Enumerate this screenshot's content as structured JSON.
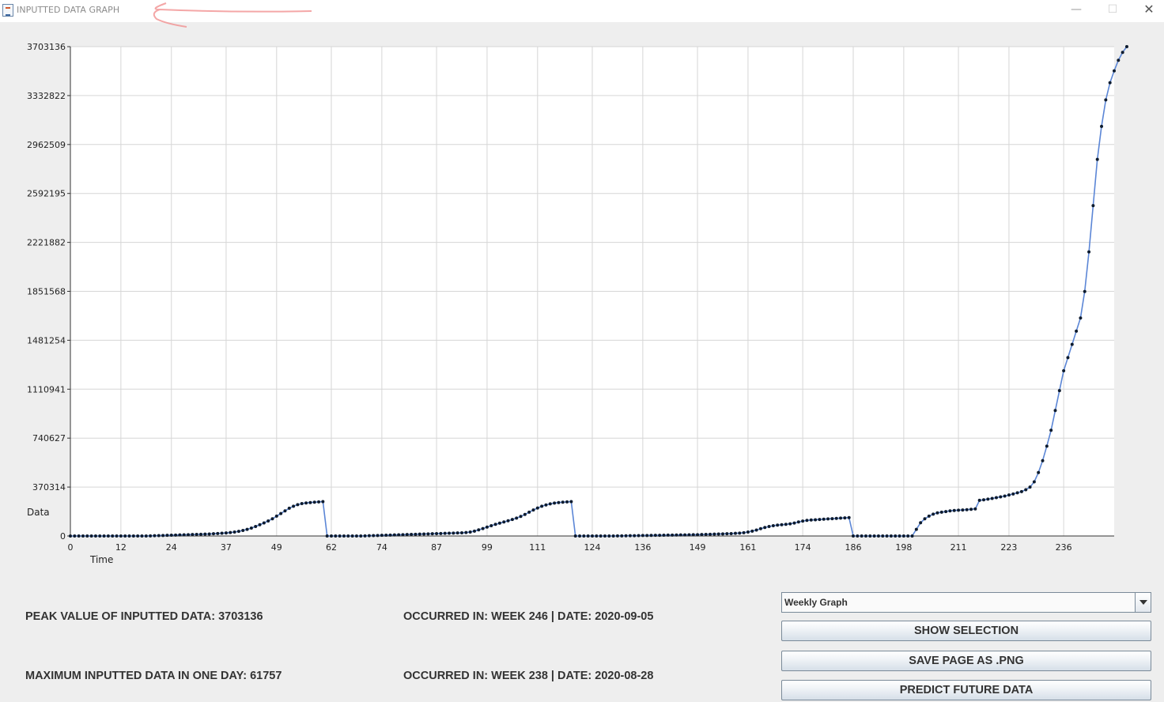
{
  "window": {
    "title": "INPUTTED DATA GRAPH",
    "controls": {
      "minimize": "—",
      "maximize": "☐",
      "close": "✕"
    }
  },
  "chart_data": {
    "type": "line",
    "title": "",
    "xlabel": "Time",
    "ylabel": "Data",
    "x_ticks": [
      "0",
      "12",
      "24",
      "37",
      "49",
      "62",
      "74",
      "87",
      "99",
      "111",
      "124",
      "136",
      "149",
      "161",
      "174",
      "186",
      "198",
      "211",
      "223",
      "236"
    ],
    "y_ticks": [
      "0",
      "370314",
      "740627",
      "1110941",
      "1481254",
      "1851568",
      "2221882",
      "2592195",
      "2962509",
      "3332822",
      "3703136"
    ],
    "xlim": [
      0,
      248
    ],
    "ylim": [
      0,
      3703136
    ],
    "grid": true,
    "line_color": "#5b86d6",
    "marker_color": "#0d1b2e",
    "series": [
      {
        "values": [
          0,
          0,
          0,
          0,
          0,
          0,
          0,
          0,
          0,
          0,
          0,
          0,
          0,
          0,
          0,
          0,
          0,
          0,
          0,
          1000,
          2000,
          3000,
          4000,
          5000,
          6000,
          7000,
          8000,
          9000,
          10000,
          11000,
          12000,
          13000,
          14000,
          15000,
          17000,
          19000,
          21000,
          23000,
          26000,
          30000,
          35000,
          42000,
          50000,
          60000,
          72000,
          85000,
          99000,
          114000,
          130000,
          150000,
          170000,
          190000,
          210000,
          225000,
          237000,
          245000,
          250000,
          253000,
          256000,
          258000,
          260000,
          0,
          0,
          0,
          0,
          0,
          0,
          0,
          0,
          0,
          1000,
          2000,
          3000,
          4000,
          5000,
          6000,
          7000,
          8000,
          9000,
          10000,
          11000,
          12000,
          13000,
          14000,
          15000,
          16000,
          17000,
          18000,
          19000,
          20000,
          21000,
          22000,
          23000,
          24000,
          26000,
          30000,
          37000,
          46000,
          56000,
          67000,
          78000,
          88000,
          97000,
          106000,
          115000,
          125000,
          135000,
          148000,
          163000,
          180000,
          197000,
          212000,
          225000,
          235000,
          243000,
          249000,
          253000,
          256000,
          258000,
          260000,
          0,
          0,
          0,
          0,
          0,
          0,
          0,
          0,
          0,
          0,
          500,
          1000,
          1500,
          2000,
          2500,
          3000,
          3500,
          4000,
          4500,
          5000,
          5500,
          6000,
          6500,
          7000,
          7500,
          8000,
          8500,
          9000,
          9500,
          10000,
          11000,
          12000,
          13000,
          14000,
          15000,
          16000,
          17000,
          18000,
          20000,
          22000,
          25000,
          30000,
          37000,
          45000,
          55000,
          64000,
          72000,
          78000,
          82000,
          85000,
          88000,
          92000,
          98000,
          106000,
          113000,
          118000,
          121000,
          123000,
          125000,
          127000,
          129000,
          131000,
          133000,
          135000,
          137000,
          139000,
          0,
          0,
          0,
          0,
          0,
          0,
          0,
          0,
          0,
          0,
          0,
          0,
          0,
          0,
          0,
          50000,
          100000,
          130000,
          150000,
          165000,
          175000,
          180000,
          185000,
          190000,
          193000,
          195000,
          197000,
          199000,
          202000,
          205000,
          270000,
          274000,
          279000,
          284000,
          290000,
          296000,
          302000,
          310000,
          318000,
          327000,
          336000,
          350000,
          370000,
          410000,
          480000,
          570000,
          680000,
          800000,
          950000,
          1100000,
          1250000,
          1350000,
          1450000,
          1550000,
          1650000,
          1850000,
          2150000,
          2500000,
          2850000,
          3100000,
          3300000,
          3430000,
          3520000,
          3600000,
          3660000,
          3703136
        ]
      }
    ]
  },
  "stats": {
    "peak_label": "PEAK VALUE OF INPUTTED DATA: 3703136",
    "peak_occurred": "OCCURRED IN: WEEK 246 | DATE: 2020-09-05",
    "max_day_label": "MAXIMUM INPUTTED DATA IN ONE DAY: 61757",
    "max_day_occurred": "OCCURRED IN: WEEK 238 | DATE: 2020-08-28"
  },
  "controls": {
    "graph_select_value": "Weekly Graph",
    "show_selection": "SHOW SELECTION",
    "save_png": "SAVE PAGE AS .PNG",
    "predict": "PREDICT FUTURE DATA"
  }
}
